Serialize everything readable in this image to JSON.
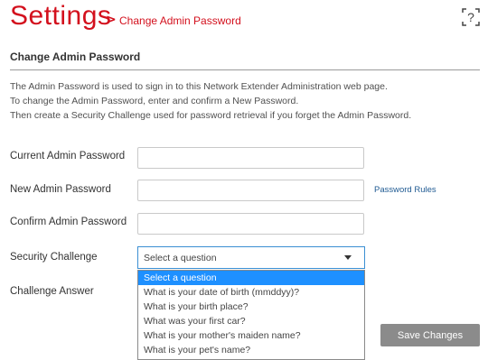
{
  "header": {
    "title": "Settings",
    "breadcrumb_separator": ">",
    "breadcrumb": "Change Admin Password",
    "help_icon_label": "?",
    "help_icon": "help-question-icon"
  },
  "section": {
    "title": "Change Admin Password"
  },
  "intro": {
    "line1": "The Admin Password is used to sign in to this Network Extender Administration web page.",
    "line2": "To change the Admin Password, enter and confirm a New Password.",
    "line3": "Then create a Security Challenge used for password retrieval if you forget the Admin Password."
  },
  "form": {
    "current_password_label": "Current Admin Password",
    "current_password_value": "",
    "new_password_label": "New Admin Password",
    "new_password_value": "",
    "password_rules_link": "Password Rules",
    "confirm_password_label": "Confirm Admin Password",
    "confirm_password_value": "",
    "security_challenge_label": "Security Challenge",
    "security_challenge_selected": "Select a question",
    "challenge_answer_label": "Challenge Answer",
    "security_options": [
      "Select a question",
      "What is your date of birth (mmddyy)?",
      "What is your birth place?",
      "What was your first car?",
      "What is your mother's maiden name?",
      "What is your pet's name?"
    ],
    "highlighted_option_index": 0
  },
  "actions": {
    "save_label": "Save Changes"
  },
  "colors": {
    "accent": "#d3101d",
    "link": "#1f5a92",
    "selected_option": "#1e90ff",
    "button": "#8b8b8b"
  }
}
